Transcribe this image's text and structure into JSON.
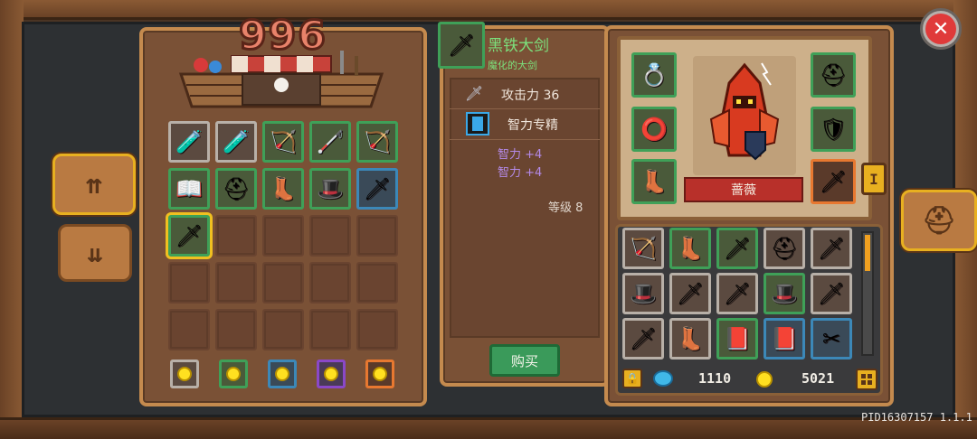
{
  "shop": {
    "count": "996",
    "rows": [
      [
        {
          "border": "gray",
          "icon": "potion-red-icon",
          "glyph": "🧪"
        },
        {
          "border": "gray",
          "icon": "potion-blue-icon",
          "glyph": "🧪"
        },
        {
          "border": "green",
          "icon": "crossbow-icon",
          "glyph": "🏹"
        },
        {
          "border": "green",
          "icon": "staff-icon",
          "glyph": "🦯"
        },
        {
          "border": "green",
          "icon": "crossbow-icon",
          "glyph": "🏹"
        }
      ],
      [
        {
          "border": "green",
          "icon": "spellbook-icon",
          "glyph": "📖"
        },
        {
          "border": "green",
          "icon": "helmet-icon",
          "glyph": "⛑"
        },
        {
          "border": "green",
          "icon": "boots-icon",
          "glyph": "👢"
        },
        {
          "border": "green",
          "icon": "hat-icon",
          "glyph": "🎩"
        },
        {
          "border": "blue",
          "icon": "sword-icon",
          "glyph": "🗡"
        }
      ],
      [
        {
          "border": "green",
          "icon": "greatsword-icon",
          "glyph": "🗡",
          "selected": true
        },
        {
          "border": "empty"
        },
        {
          "border": "empty"
        },
        {
          "border": "empty"
        },
        {
          "border": "empty"
        }
      ],
      [
        {
          "border": "empty"
        },
        {
          "border": "empty"
        },
        {
          "border": "empty"
        },
        {
          "border": "empty"
        },
        {
          "border": "empty"
        }
      ],
      [
        {
          "border": "empty"
        },
        {
          "border": "empty"
        },
        {
          "border": "empty"
        },
        {
          "border": "empty"
        },
        {
          "border": "empty"
        }
      ]
    ],
    "filters": [
      {
        "border": "gray",
        "icon": "coin-icon"
      },
      {
        "border": "green",
        "icon": "coin-icon"
      },
      {
        "border": "blue",
        "icon": "coin-icon"
      },
      {
        "border": "purple",
        "icon": "coin-icon"
      },
      {
        "border": "orange",
        "icon": "coin-icon"
      }
    ]
  },
  "item": {
    "name": "黑铁大剑",
    "subtitle": "魔化的大剑",
    "attack_label": "攻击力",
    "attack_value": "36",
    "perk": "智力专精",
    "bonus1": "智力 +4",
    "bonus2": "智力 +4",
    "level": "等级 8",
    "buy_label": "购买"
  },
  "character": {
    "name": "蔷薇",
    "equip": [
      {
        "border": "green",
        "icon": "ring-icon",
        "glyph": "💍"
      },
      {
        "border": "green",
        "icon": "ring-icon",
        "glyph": "⭕"
      },
      {
        "border": "green",
        "icon": "boots-icon",
        "glyph": "👢"
      },
      {
        "border": "green",
        "icon": "helmet-icon",
        "glyph": "⛑"
      },
      {
        "border": "green",
        "icon": "armor-icon",
        "glyph": "🛡"
      },
      {
        "border": "orange",
        "icon": "spear-icon",
        "glyph": "🗡"
      }
    ]
  },
  "inventory": [
    [
      {
        "border": "gray",
        "icon": "crossbow-icon",
        "glyph": "🏹"
      },
      {
        "border": "green",
        "icon": "boots-icon",
        "glyph": "👢"
      },
      {
        "border": "green",
        "icon": "greatsword-icon",
        "glyph": "🗡"
      },
      {
        "border": "gray",
        "icon": "helmet-icon",
        "glyph": "⛑"
      },
      {
        "border": "gray",
        "icon": "greatsword-icon",
        "glyph": "🗡"
      }
    ],
    [
      {
        "border": "gray",
        "icon": "hat-icon",
        "glyph": "🎩"
      },
      {
        "border": "gray",
        "icon": "greatsword-icon",
        "glyph": "🗡"
      },
      {
        "border": "gray",
        "icon": "greatsword-icon",
        "glyph": "🗡"
      },
      {
        "border": "green",
        "icon": "hat-icon",
        "glyph": "🎩"
      },
      {
        "border": "gray",
        "icon": "spear-icon",
        "glyph": "🗡"
      }
    ],
    [
      {
        "border": "gray",
        "icon": "spear-icon",
        "glyph": "🗡"
      },
      {
        "border": "gray",
        "icon": "boots-icon",
        "glyph": "👢"
      },
      {
        "border": "green",
        "icon": "spellbook-icon",
        "glyph": "📕"
      },
      {
        "border": "blue",
        "icon": "spellbook-icon",
        "glyph": "📕"
      },
      {
        "border": "blue",
        "icon": "claw-icon",
        "glyph": "✂"
      }
    ]
  ],
  "currency": {
    "gems": "1110",
    "coins": "5021"
  },
  "colors": {
    "gem": "#40b8e8",
    "coin": "#ffe020"
  },
  "footer": {
    "pid": "PID16307157 1.1.1"
  }
}
